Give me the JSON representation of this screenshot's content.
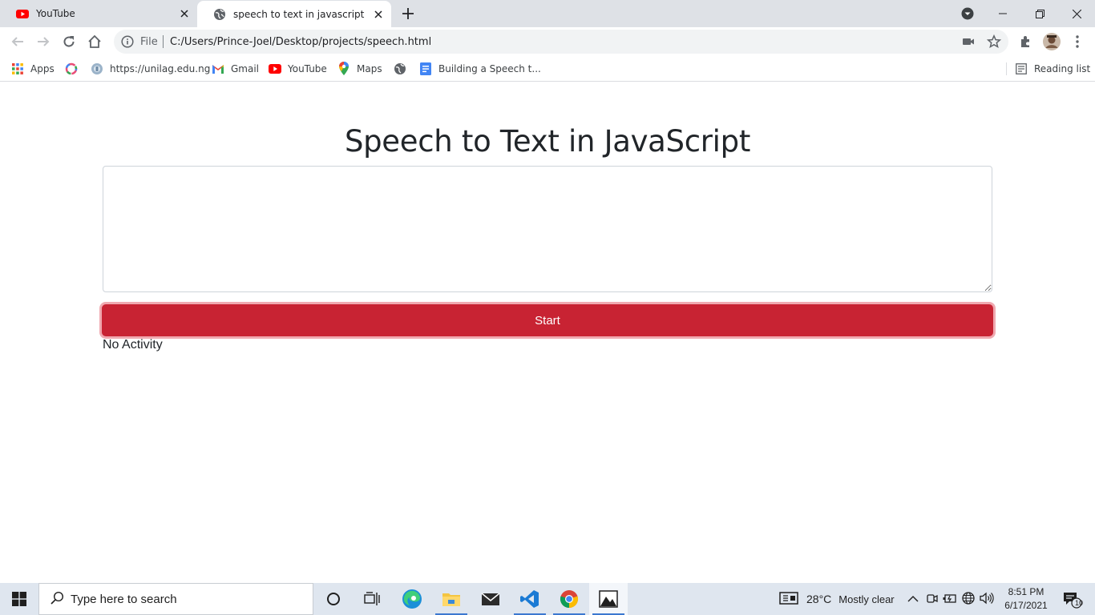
{
  "browser": {
    "tabs": [
      {
        "title": "YouTube",
        "active": false,
        "icon": "youtube-icon"
      },
      {
        "title": "speech to text in javascript",
        "active": true,
        "icon": "globe-icon"
      }
    ],
    "address": {
      "scheme_label": "File",
      "url": "C:/Users/Prince-Joel/Desktop/projects/speech.html"
    },
    "bookmarks": [
      {
        "label": "Apps",
        "icon": "apps-grid-icon"
      },
      {
        "label": "",
        "icon": "colorful-ring-icon"
      },
      {
        "label": "https://unilag.edu.ng",
        "icon": "unilag-icon"
      },
      {
        "label": "Gmail",
        "icon": "gmail-icon"
      },
      {
        "label": "YouTube",
        "icon": "youtube-icon"
      },
      {
        "label": "Maps",
        "icon": "maps-icon"
      },
      {
        "label": "",
        "icon": "globe-icon"
      },
      {
        "label": "Building a Speech t...",
        "icon": "docs-icon"
      }
    ],
    "reading_list_label": "Reading list"
  },
  "page": {
    "title": "Speech to Text in JavaScript",
    "textarea_value": "",
    "start_button_label": "Start",
    "status": "No Activity",
    "accent_color": "#c82333"
  },
  "taskbar": {
    "search_placeholder": "Type here to search",
    "weather": {
      "temp": "28°C",
      "condition": "Mostly clear"
    },
    "time": "8:51 PM",
    "date": "6/17/2021",
    "notification_count": "10"
  }
}
